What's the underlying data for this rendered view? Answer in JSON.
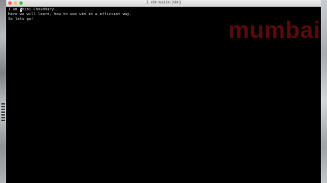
{
  "window": {
    "title": "1. vim test.txt (vim)"
  },
  "terminal": {
    "line1_before_cursor": "I am ",
    "line1_cursor_char": "S",
    "line1_after_cursor": "hini Choudhary.",
    "line2": "Here we will learn, how to use vim in a efficient way.",
    "line3": "So lets go!"
  },
  "watermark": {
    "text": "mumbai"
  },
  "colors": {
    "terminal_bg": "#000000",
    "terminal_fg": "#d9d9d9",
    "watermark": "#5a0a0a",
    "close": "#fc605c",
    "minimize": "#fdbc40",
    "maximize": "#34c84a"
  }
}
